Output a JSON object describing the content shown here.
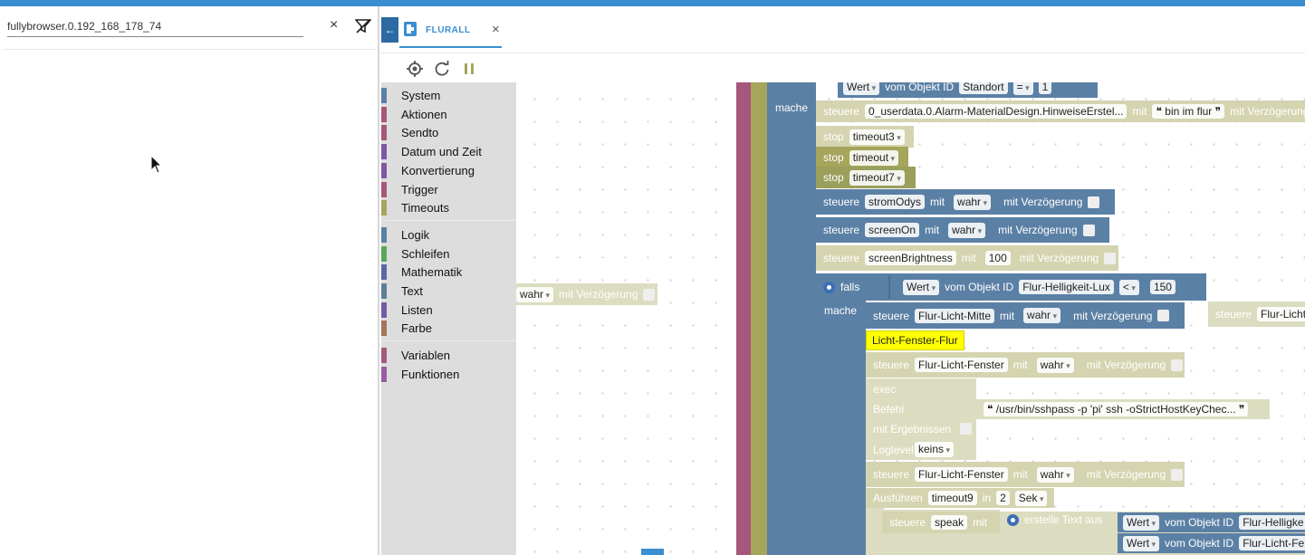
{
  "left_panel": {
    "filter_value": "fullybrowser.0.192_168_178_74",
    "clear_symbol": "×"
  },
  "tabs": [
    {
      "label": "FLURALL",
      "close": "×"
    }
  ],
  "back_symbol": "←",
  "toolbox": {
    "groups": [
      [
        {
          "label": "System",
          "color": "#5b80a5"
        },
        {
          "label": "Aktionen",
          "color": "#a5577c"
        },
        {
          "label": "Sendto",
          "color": "#a5577c"
        },
        {
          "label": "Datum und Zeit",
          "color": "#7e57a5"
        },
        {
          "label": "Konvertierung",
          "color": "#7e57a5"
        },
        {
          "label": "Trigger",
          "color": "#a5577c"
        },
        {
          "label": "Timeouts",
          "color": "#a5a55c"
        }
      ],
      [
        {
          "label": "Logik",
          "color": "#5b80a5"
        },
        {
          "label": "Schleifen",
          "color": "#5ba55b"
        },
        {
          "label": "Mathematik",
          "color": "#5b67a5"
        },
        {
          "label": "Text",
          "color": "#5b8095"
        },
        {
          "label": "Listen",
          "color": "#745ba5"
        },
        {
          "label": "Farbe",
          "color": "#a5745b"
        }
      ],
      [
        {
          "label": "Variablen",
          "color": "#a55b80"
        },
        {
          "label": "Funktionen",
          "color": "#995ba5"
        }
      ]
    ]
  },
  "blocks": {
    "top": {
      "wert": "Wert",
      "vom": "vom Objekt ID",
      "id": "Standort",
      "op": "=",
      "val": "1"
    },
    "falls": "falls",
    "mache": "mache",
    "steuere": "steuere",
    "mit": "mit",
    "mit_verz": "mit Verzögerung",
    "stop": "stop",
    "hinweise_obj": "0_userdata.0.Alarm-MaterialDesign.HinweiseErstel...",
    "bin_im_flur": "bin im flur",
    "timeout3": "timeout3",
    "timeout": "timeout",
    "timeout7": "timeout7",
    "stromOdys": "stromOdys",
    "screenOn": "screenOn",
    "screenBrightness": "screenBrightness",
    "wahr": "wahr",
    "hundred": "100",
    "flur_lux": "Flur-Helligkeit-Lux",
    "lt": "<",
    "v150": "150",
    "flur_mitte": "Flur-Licht-Mitte",
    "flur_licht_short": "Flur-Licht",
    "note": "Licht-Fenster-Flur",
    "flur_fenster": "Flur-Licht-Fenster",
    "exec": "exec",
    "befehl": "Befehl",
    "cmd": "/usr/bin/sshpass -p 'pi' ssh -oStrictHostKeyChec...",
    "mit_ergebnissen": "mit Ergebnissen",
    "loglevel": "Loglevel",
    "keins": "keins",
    "ausfuehren": "Ausführen",
    "timeout9": "timeout9",
    "in": "in",
    "two": "2",
    "sek": "Sek",
    "speak": "speak",
    "erstelle": "erstelle Text aus",
    "flur_hellig_trunc": "Flur-Helligke",
    "flur_fe_trunc": "Flur-Licht-Fe"
  }
}
